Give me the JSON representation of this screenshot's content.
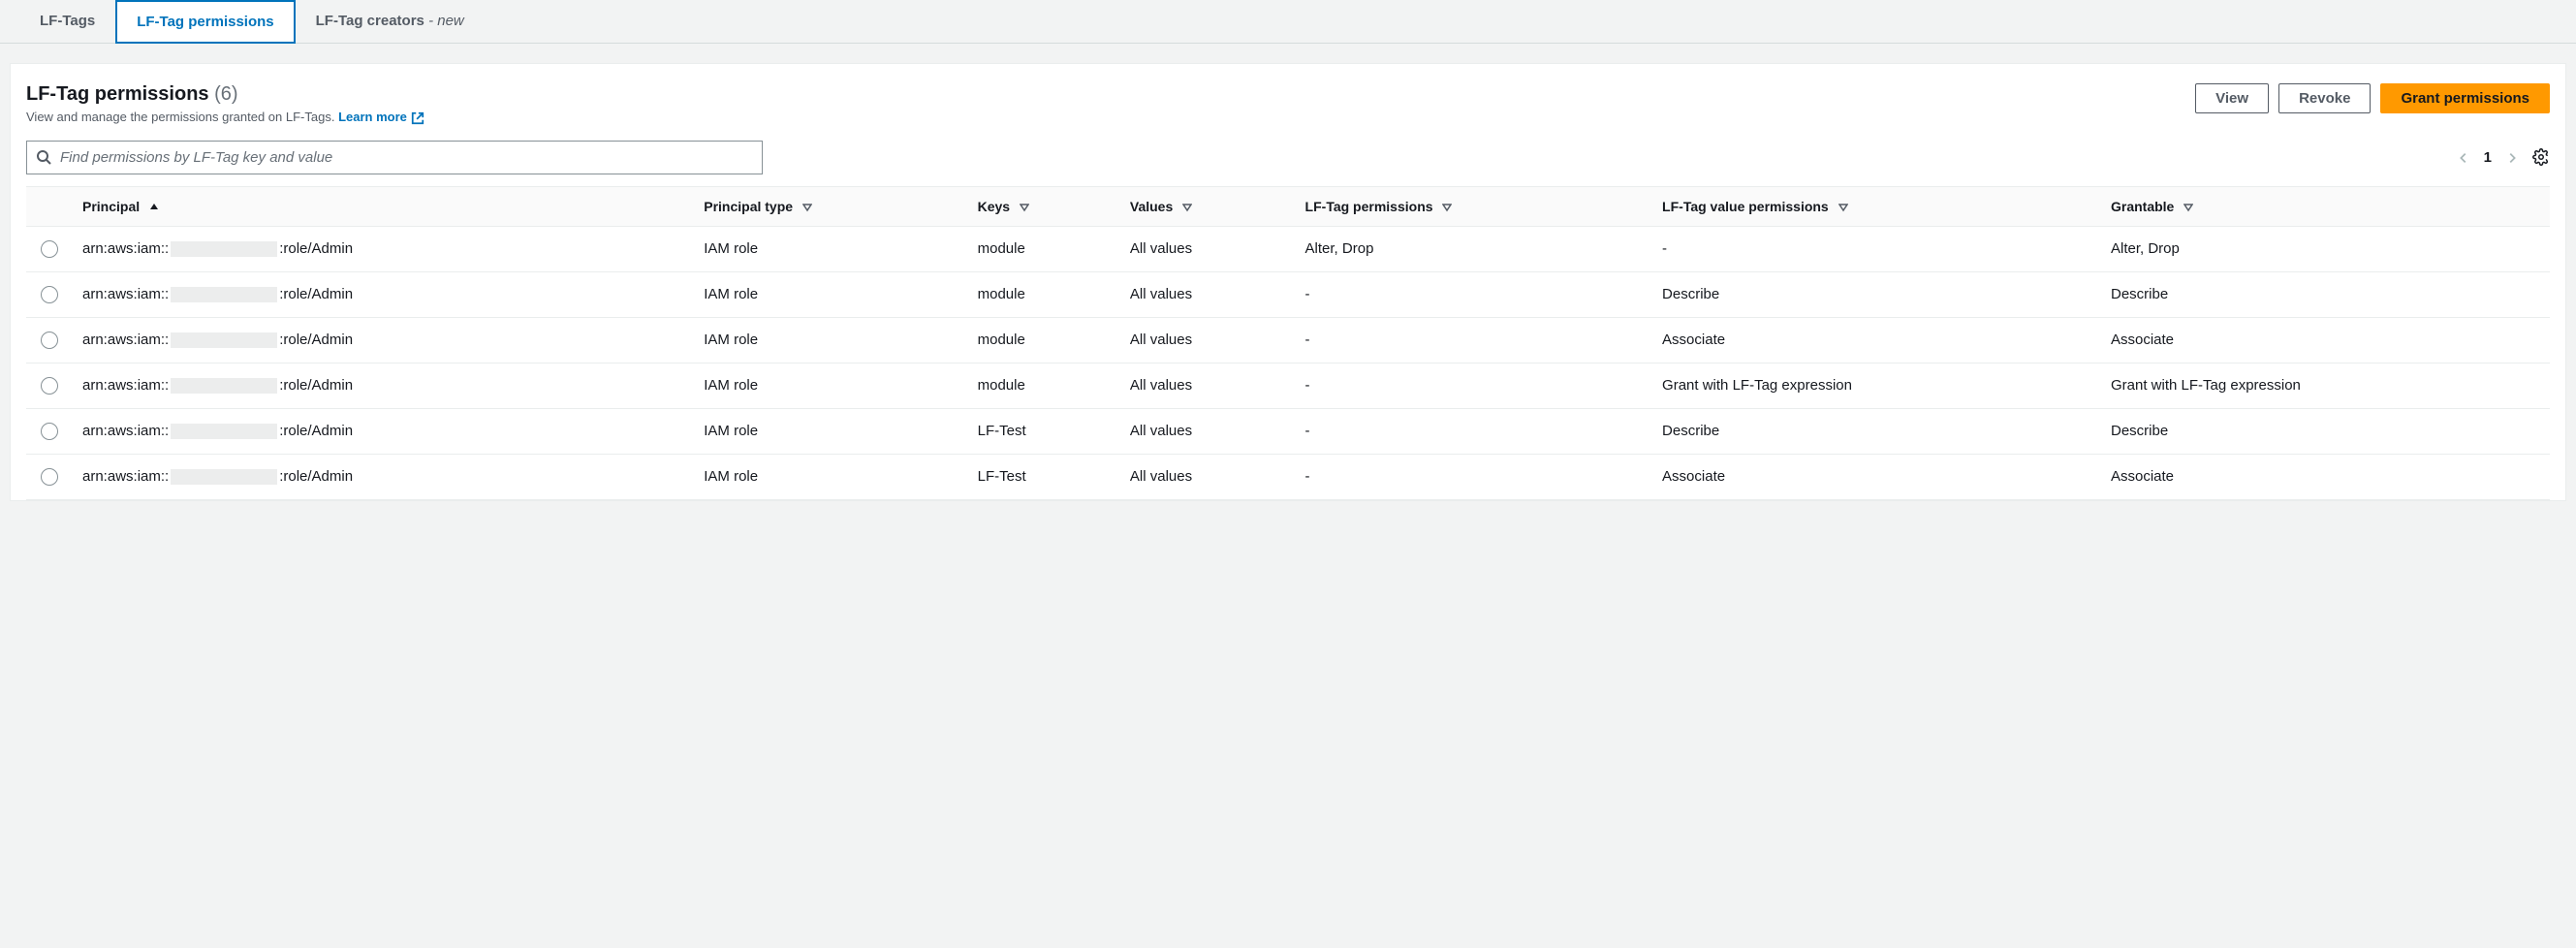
{
  "tabs": [
    {
      "label": "LF-Tags",
      "active": false,
      "new": false
    },
    {
      "label": "LF-Tag permissions",
      "active": true,
      "new": false
    },
    {
      "label": "LF-Tag creators",
      "active": false,
      "new": true,
      "suffix": "- new"
    }
  ],
  "header": {
    "title": "LF-Tag permissions",
    "count": "(6)",
    "subtitle": "View and manage the permissions granted on LF-Tags.",
    "learn_more": "Learn more"
  },
  "actions": {
    "view": "View",
    "revoke": "Revoke",
    "grant": "Grant permissions"
  },
  "search": {
    "placeholder": "Find permissions by LF-Tag key and value"
  },
  "pager": {
    "page": "1"
  },
  "columns": {
    "principal": "Principal",
    "principal_type": "Principal type",
    "keys": "Keys",
    "values": "Values",
    "lf_tag_permissions": "LF-Tag permissions",
    "lf_tag_value_permissions": "LF-Tag value permissions",
    "grantable": "Grantable"
  },
  "rows": [
    {
      "principal_prefix": "arn:aws:iam::",
      "principal_suffix": ":role/Admin",
      "principal_type": "IAM role",
      "keys": "module",
      "values": "All values",
      "lf_tag_permissions": "Alter, Drop",
      "lf_tag_value_permissions": "-",
      "grantable": "Alter, Drop"
    },
    {
      "principal_prefix": "arn:aws:iam::",
      "principal_suffix": ":role/Admin",
      "principal_type": "IAM role",
      "keys": "module",
      "values": "All values",
      "lf_tag_permissions": "-",
      "lf_tag_value_permissions": "Describe",
      "grantable": "Describe"
    },
    {
      "principal_prefix": "arn:aws:iam::",
      "principal_suffix": ":role/Admin",
      "principal_type": "IAM role",
      "keys": "module",
      "values": "All values",
      "lf_tag_permissions": "-",
      "lf_tag_value_permissions": "Associate",
      "grantable": "Associate"
    },
    {
      "principal_prefix": "arn:aws:iam::",
      "principal_suffix": ":role/Admin",
      "principal_type": "IAM role",
      "keys": "module",
      "values": "All values",
      "lf_tag_permissions": "-",
      "lf_tag_value_permissions": "Grant with LF-Tag expression",
      "grantable": "Grant with LF-Tag expression"
    },
    {
      "principal_prefix": "arn:aws:iam::",
      "principal_suffix": ":role/Admin",
      "principal_type": "IAM role",
      "keys": "LF-Test",
      "values": "All values",
      "lf_tag_permissions": "-",
      "lf_tag_value_permissions": "Describe",
      "grantable": "Describe"
    },
    {
      "principal_prefix": "arn:aws:iam::",
      "principal_suffix": ":role/Admin",
      "principal_type": "IAM role",
      "keys": "LF-Test",
      "values": "All values",
      "lf_tag_permissions": "-",
      "lf_tag_value_permissions": "Associate",
      "grantable": "Associate"
    }
  ]
}
